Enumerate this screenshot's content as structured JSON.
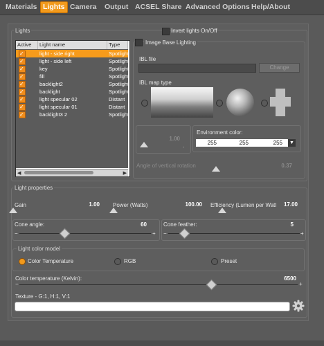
{
  "menu": [
    "Materials",
    "Lights",
    "Camera",
    "Output",
    "ACSEL Share",
    "Advanced Options",
    "Help/About"
  ],
  "active_menu": "Lights",
  "lights_group": {
    "title": "Lights",
    "invert_label": "Invert lights On/Off"
  },
  "table": {
    "headers": [
      "Active",
      "Light name",
      "Type"
    ],
    "rows": [
      {
        "name": "light - side right",
        "type": "Spotlight",
        "active": true,
        "selected": true
      },
      {
        "name": "light - side left",
        "type": "Spotlight",
        "active": true
      },
      {
        "name": "key",
        "type": "Spotlight",
        "active": true
      },
      {
        "name": "fill",
        "type": "Spotlight",
        "active": true
      },
      {
        "name": "backlight2",
        "type": "Spotlight",
        "active": true
      },
      {
        "name": "backlight",
        "type": "Spotlight",
        "active": true
      },
      {
        "name": "light specular 02",
        "type": "Distant",
        "active": true
      },
      {
        "name": "light specular 01",
        "type": "Distant",
        "active": true
      },
      {
        "name": "backlight3 2",
        "type": "Spotlight",
        "active": true
      }
    ]
  },
  "ibl": {
    "title": "Image Base Lighting",
    "file_label": "IBL file",
    "change_label": "Change",
    "map_type_label": "IBL map type",
    "intensity_value": "1.00",
    "env_color_label": "Environment color:",
    "env_color": [
      "255",
      "255",
      "255"
    ],
    "angle_label": "Angle of vertical rotation",
    "angle_value": "0.37"
  },
  "light_props": {
    "title": "Light properties",
    "gain_label": "Gain",
    "gain_value": "1.00",
    "power_label": "Power (Watts)",
    "power_value": "100.00",
    "efficiency_label": "Efficiency (Lumen per Watt)",
    "efficiency_value": "17.00",
    "cone_angle_label": "Cone angle:",
    "cone_angle_value": "60",
    "cone_feather_label": "Cone feather:",
    "cone_feather_value": "5",
    "color_model_title": "Light color model",
    "color_models": [
      "Color Temperature",
      "RGB",
      "Preset"
    ],
    "selected_color_model": "Color Temperature",
    "color_temp_label": "Color temperature (Kelvin):",
    "color_temp_value": "6500",
    "texture_label": "Texture - G:1, H:1, V:1",
    "texture_value": ""
  },
  "colors": {
    "accent": "#f29a1c",
    "panel": "#5e5e5e",
    "menubar": "#4c4c4c"
  },
  "icons": {
    "settings": "gear-icon"
  }
}
